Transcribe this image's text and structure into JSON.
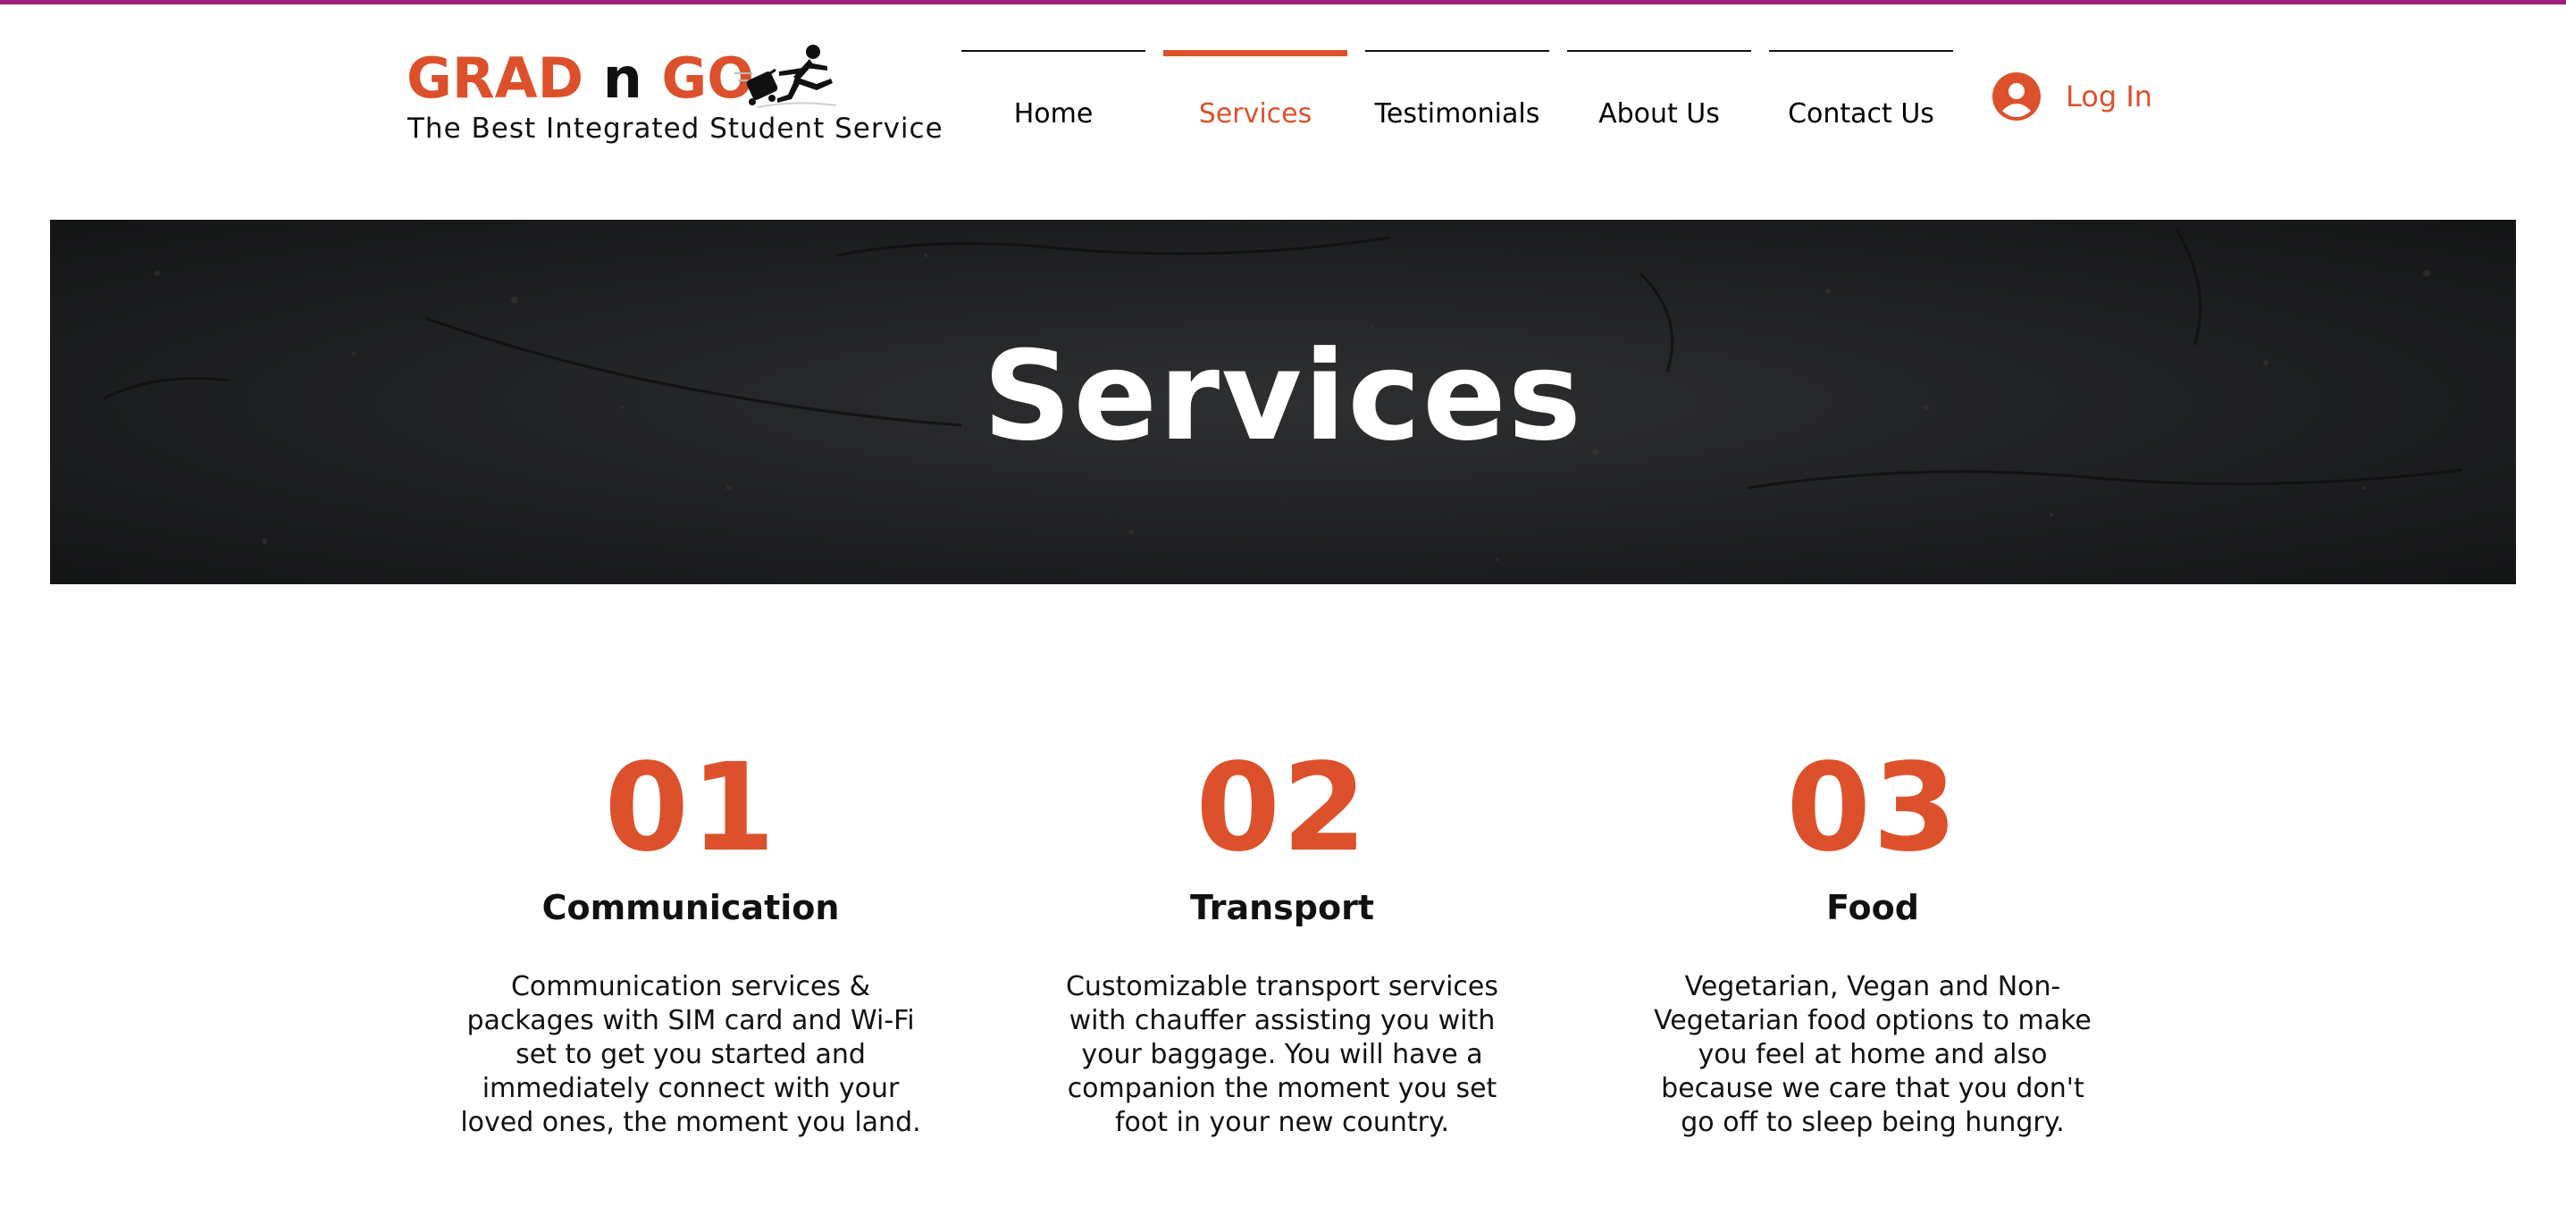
{
  "brand": {
    "title_part1": "GRAD",
    "title_part2": "n",
    "title_part3": "GO",
    "tagline": "The Best Integrated Student Service",
    "runner_icon": "runner-with-suitcase-icon"
  },
  "nav": {
    "items": [
      {
        "label": "Home",
        "active": false
      },
      {
        "label": "Services",
        "active": true
      },
      {
        "label": "Testimonials",
        "active": false
      },
      {
        "label": "About Us",
        "active": false
      },
      {
        "label": "Contact Us",
        "active": false
      }
    ],
    "login_label": "Log In",
    "login_icon": "user-avatar-icon"
  },
  "hero": {
    "title": "Services"
  },
  "services": [
    {
      "number": "01",
      "title": "Communication",
      "description": "Communication services & packages with SIM card and Wi-Fi set to get you started and immediately connect with your loved ones, the moment you land."
    },
    {
      "number": "02",
      "title": "Transport",
      "description": "Customizable transport services with chauffer assisting you with your baggage. You will have a companion the moment you set foot in your new country."
    },
    {
      "number": "03",
      "title": "Food",
      "description": "Vegetarian, Vegan and Non-Vegetarian food options to make you feel at home and also because we care that you don't go off to sleep being hungry."
    }
  ],
  "colors": {
    "accent": "#dc512b",
    "top_border": "#a0207e",
    "hero_background": "#222325",
    "text": "#111111"
  }
}
